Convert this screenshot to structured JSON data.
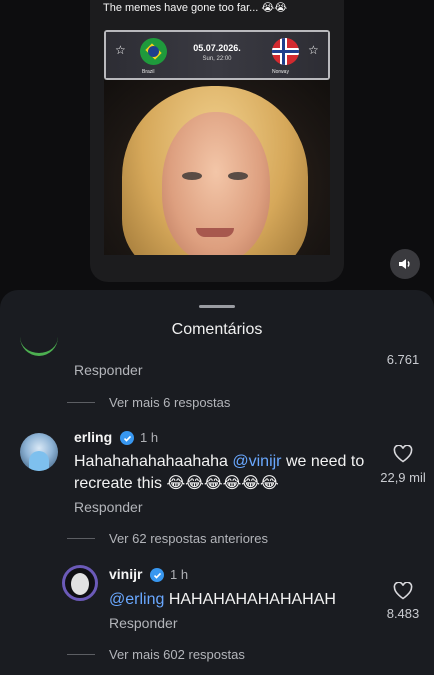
{
  "post": {
    "caption": "The memes have gone too far... 😭😭",
    "match": {
      "date": "05.07.2026.",
      "time": "Sun, 22:00",
      "home": "Brazil",
      "away": "Norway"
    }
  },
  "comments_sheet": {
    "title": "Comentários",
    "reply_label": "Responder",
    "top_partial": {
      "likes": "6.761",
      "view_more": "Ver mais 6 respostas"
    },
    "comments": [
      {
        "username": "erling",
        "time": "1 h",
        "text_before": "Hahahahahahaahaha ",
        "mention": "@vinijr",
        "text_after": " we need to recreate this 😂😂😂😂😂😂",
        "likes": "22,9 mil",
        "prev_replies": "Ver 62 respostas anteriores"
      },
      {
        "username": "vinijr",
        "time": "1 h",
        "mention": "@erling",
        "text_after": " HAHAHAHAHAHAHAH",
        "likes": "8.483",
        "view_more": "Ver mais 602 respostas"
      }
    ]
  },
  "colors": {
    "background": "#0d0d0f",
    "sheet": "#1a1c21",
    "mention": "#6aa8ff",
    "verified": "#3897f0"
  },
  "icons": [
    "star-icon",
    "volume-icon",
    "verified-icon",
    "heart-icon"
  ]
}
